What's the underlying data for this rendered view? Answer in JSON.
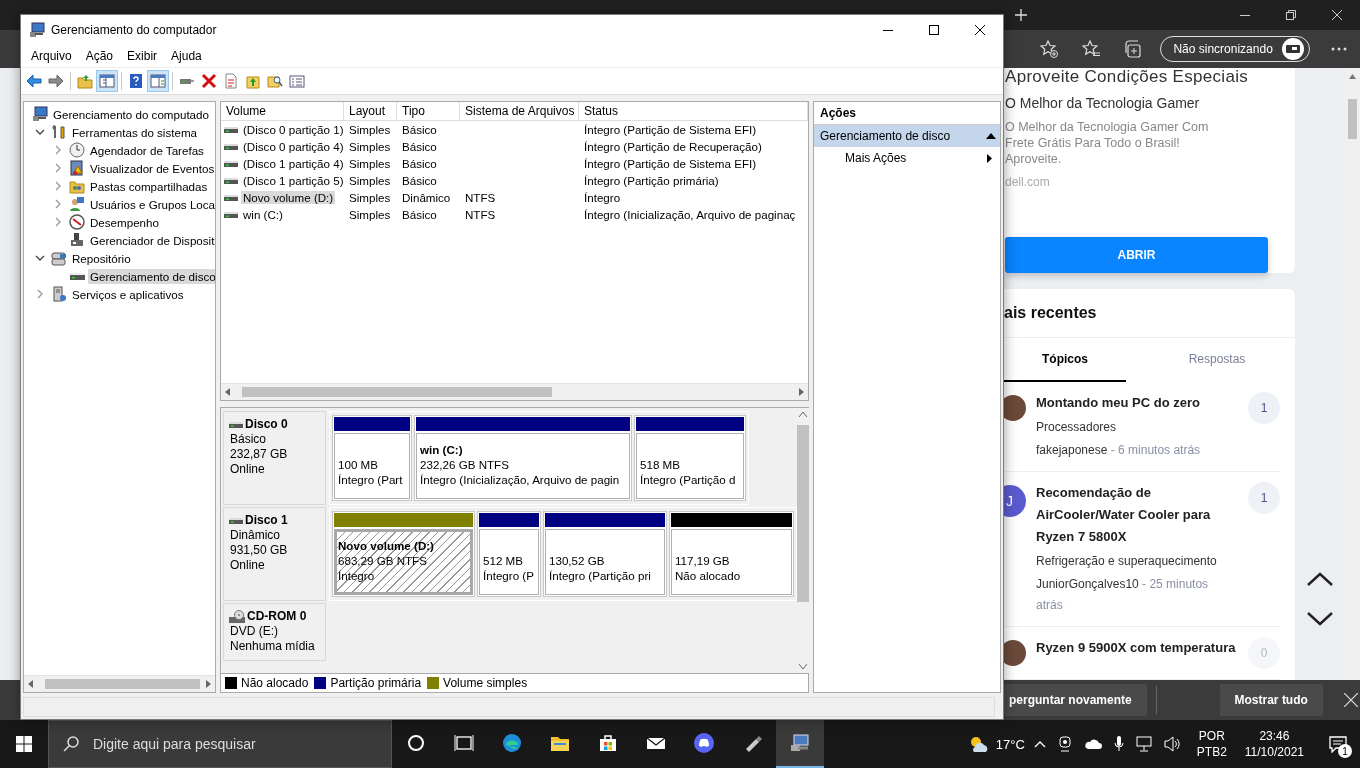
{
  "browser": {
    "sync_button": "Não sincronizando",
    "ad": {
      "title": "Aproveite Condições Especiais",
      "subtitle": "O Melhor da Tecnologia Gamer",
      "text": "O Melhor da Tecnologia Gamer Com Frete Grátis Para Todo o Brasil! Aproveite.",
      "domain": "dell.com",
      "button": "ABRIR"
    },
    "recent": {
      "title": "ais recentes",
      "tabs": [
        {
          "label": "Tópicos",
          "selected": true
        },
        {
          "label": "Respostas",
          "selected": false
        }
      ],
      "topics": [
        {
          "title": "Montando meu PC do zero",
          "category": "Processadores",
          "author": "fakejaponese",
          "time": "- 6 minutos atrás",
          "count": "1"
        },
        {
          "title": "Recomendação de AirCooler/Water Cooler para Ryzen 7 5800X",
          "category": "Refrigeração e superaquecimento",
          "author": "JuniorGonçalves10",
          "time": "- 25 minutos atrás",
          "count": "1",
          "initial": "J"
        },
        {
          "title": "Ryzen 9 5900X com temperatura",
          "count": "0"
        }
      ]
    },
    "download_bar": {
      "button": "perguntar novamente",
      "show_all": "Mostrar tudo"
    }
  },
  "window": {
    "title": "Gerenciamento do computador",
    "menu": [
      "Arquivo",
      "Ação",
      "Exibir",
      "Ajuda"
    ],
    "toolbar": [
      {
        "kind": "back",
        "pressed": false
      },
      {
        "kind": "forward",
        "pressed": false
      },
      {
        "kind": "separator"
      },
      {
        "kind": "folder-up",
        "pressed": false
      },
      {
        "kind": "console-tree",
        "pressed": true
      },
      {
        "kind": "separator"
      },
      {
        "kind": "help",
        "pressed": false
      },
      {
        "kind": "action-pane",
        "pressed": true
      },
      {
        "kind": "separator"
      },
      {
        "kind": "connect",
        "pressed": false
      },
      {
        "kind": "delete",
        "pressed": false
      },
      {
        "kind": "properties",
        "pressed": false
      },
      {
        "kind": "export",
        "pressed": false
      },
      {
        "kind": "search",
        "pressed": false
      },
      {
        "kind": "list",
        "pressed": false
      }
    ],
    "tree": [
      {
        "label": "Gerenciamento do computado",
        "kind": "root",
        "selected": false,
        "children": [
          {
            "label": "Ferramentas do sistema",
            "kind": "folder",
            "expanded": true,
            "selected": false,
            "children": [
              {
                "label": "Agendador de Tarefas",
                "kind": "folder",
                "expanded": false,
                "selected": false
              },
              {
                "label": "Visualizador de Eventos",
                "kind": "folder",
                "expanded": false,
                "selected": false
              },
              {
                "label": "Pastas compartilhadas",
                "kind": "folder",
                "expanded": false,
                "selected": false
              },
              {
                "label": "Usuários e Grupos Loca",
                "kind": "folder",
                "expanded": false,
                "selected": false
              },
              {
                "label": "Desempenho",
                "kind": "folder",
                "expanded": false,
                "selected": false
              },
              {
                "label": "Gerenciador de Disposit",
                "kind": "leaf",
                "selected": false
              }
            ]
          },
          {
            "label": "Repositório",
            "kind": "folder",
            "expanded": true,
            "selected": false,
            "children": [
              {
                "label": "Gerenciamento de disco",
                "kind": "leaf",
                "selected": true
              }
            ]
          },
          {
            "label": "Serviços e aplicativos",
            "kind": "folder",
            "expanded": false,
            "selected": false
          }
        ]
      }
    ],
    "volumes": {
      "columns": [
        "Volume",
        "Layout",
        "Tipo",
        "Sistema de Arquivos",
        "Status"
      ],
      "rows": [
        {
          "volume": "(Disco 0 partição 1)",
          "layout": "Simples",
          "type": "Básico",
          "status": "Íntegro (Partição de Sistema EFI)",
          "selected": false
        },
        {
          "volume": "(Disco 0 partição 4)",
          "layout": "Simples",
          "type": "Básico",
          "status": "Íntegro (Partição de Recuperação)",
          "selected": false
        },
        {
          "volume": "(Disco 1 partição 4)",
          "layout": "Simples",
          "type": "Básico",
          "status": "Íntegro (Partição de Sistema EFI)",
          "selected": false
        },
        {
          "volume": "(Disco 1 partição 5)",
          "layout": "Simples",
          "type": "Básico",
          "status": "Íntegro (Partição primária)",
          "selected": false
        },
        {
          "volume": "Novo volume (D:)",
          "layout": "Simples",
          "type": "Dinâmico",
          "filesystem": "NTFS",
          "status": "Íntegro",
          "selected": true
        },
        {
          "volume": "win (C:)",
          "layout": "Simples",
          "type": "Básico",
          "filesystem": "NTFS",
          "status": "Íntegro (Inicialização, Arquivo de paginaç",
          "selected": false
        }
      ]
    },
    "disks": [
      {
        "kind": "disk",
        "name": "Disco 0",
        "lines": [
          "Básico",
          "232,87 GB",
          "Online"
        ],
        "partitions": [
          {
            "kind": "primary",
            "size": "100 MB",
            "status": "Íntegro (Part",
            "selected": false
          },
          {
            "kind": "primary",
            "name": "win  (C:)",
            "size": "232,26 GB NTFS",
            "status": "Íntegro (Inicialização, Arquivo de pagin",
            "selected": false
          },
          {
            "kind": "primary",
            "size": "518 MB",
            "status": "Íntegro (Partição d",
            "selected": false
          }
        ]
      },
      {
        "kind": "disk",
        "name": "Disco 1",
        "lines": [
          "Dinâmico",
          "931,50 GB",
          "Online"
        ],
        "partitions": [
          {
            "kind": "simple",
            "name": "Novo volume  (D:)",
            "size": "683,29 GB NTFS",
            "status": "Íntegro",
            "selected": true
          },
          {
            "kind": "primary",
            "size": "512 MB",
            "status": "Íntegro (P",
            "selected": false
          },
          {
            "kind": "primary",
            "size": "130,52 GB",
            "status": "Íntegro (Partição pri",
            "selected": false
          },
          {
            "kind": "unallocated",
            "size": "117,19 GB",
            "status": "Não alocado",
            "selected": false
          }
        ]
      },
      {
        "kind": "cdrom",
        "name": "CD-ROM 0",
        "lines": [
          "DVD (E:)",
          "Nenhuma mídia"
        ]
      }
    ],
    "legend": [
      {
        "kind": "unallocated",
        "label": "Não alocado",
        "color": "#000000"
      },
      {
        "kind": "primary",
        "label": "Partição primária",
        "color": "#000080"
      },
      {
        "kind": "simple",
        "label": "Volume simples",
        "color": "#808000"
      }
    ],
    "actions": {
      "title": "Ações",
      "section": "Gerenciamento de disco",
      "items": [
        "Mais Ações"
      ]
    }
  },
  "taskbar": {
    "search_placeholder": "Digite aqui para pesquisar",
    "apps": [
      {
        "kind": "cortana",
        "active": false
      },
      {
        "kind": "task-view",
        "active": false
      },
      {
        "kind": "edge",
        "active": false
      },
      {
        "kind": "explorer",
        "active": false
      },
      {
        "kind": "store",
        "active": false
      },
      {
        "kind": "mail",
        "active": false
      },
      {
        "kind": "discord",
        "active": false
      },
      {
        "kind": "usb",
        "active": false
      },
      {
        "kind": "computer-management",
        "active": true
      }
    ],
    "temperature": "17°C",
    "language": "POR",
    "keyboard": "PTB2",
    "time": "23:46",
    "date": "11/10/2021",
    "notifications": "1"
  }
}
